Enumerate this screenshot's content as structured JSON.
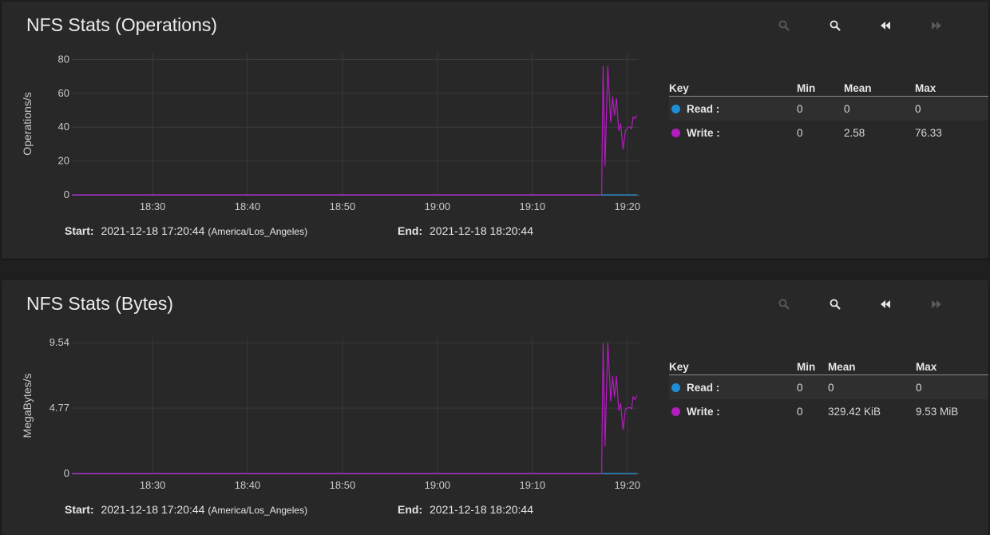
{
  "panels": [
    {
      "title": "NFS Stats (Operations)",
      "toolbar": {
        "zoom_in_icon": "zoom-in-icon",
        "zoom_out_icon": "zoom-out-icon",
        "back_icon": "rewind-icon",
        "forward_icon": "fast-forward-icon"
      },
      "footer": {
        "start_label": "Start:",
        "start_value": "2021-12-18 17:20:44",
        "start_tz": "(America/Los_Angeles)",
        "end_label": "End:",
        "end_value": "2021-12-18 18:20:44"
      },
      "legend": {
        "headers": [
          "Key",
          "Min",
          "Mean",
          "Max"
        ],
        "rows": [
          {
            "name": "Read :",
            "color": "#1e8fd6",
            "min": "0",
            "mean": "0",
            "max": "0"
          },
          {
            "name": "Write :",
            "color": "#b41cc0",
            "min": "0",
            "mean": "2.58",
            "max": "76.33"
          }
        ]
      }
    },
    {
      "title": "NFS Stats (Bytes)",
      "toolbar": {
        "zoom_in_icon": "zoom-in-icon",
        "zoom_out_icon": "zoom-out-icon",
        "back_icon": "rewind-icon",
        "forward_icon": "fast-forward-icon"
      },
      "footer": {
        "start_label": "Start:",
        "start_value": "2021-12-18 17:20:44",
        "start_tz": "(America/Los_Angeles)",
        "end_label": "End:",
        "end_value": "2021-12-18 18:20:44"
      },
      "legend": {
        "headers": [
          "Key",
          "Min",
          "Mean",
          "Max"
        ],
        "rows": [
          {
            "name": "Read :",
            "color": "#1e8fd6",
            "min": "0",
            "mean": "0",
            "max": "0"
          },
          {
            "name": "Write :",
            "color": "#b41cc0",
            "min": "0",
            "mean": "329.42 KiB",
            "max": "9.53 MiB"
          }
        ]
      }
    }
  ],
  "chart_data": [
    {
      "type": "line",
      "ylabel": "Operations/s",
      "ylim": [
        0,
        84
      ],
      "yticks": [
        0,
        20,
        40,
        60,
        80
      ],
      "ytick_labels": [
        "0",
        "20",
        "40",
        "60",
        "80"
      ],
      "xlim_minutes": [
        -58.5,
        1.2
      ],
      "xticks_minutes": [
        -50,
        -40,
        -30,
        -20,
        -10,
        0
      ],
      "xtick_labels": [
        "18:30",
        "18:40",
        "18:50",
        "19:00",
        "19:10",
        "19:20"
      ],
      "grid": true,
      "series": [
        {
          "name": "Read",
          "color": "#1e8fd6",
          "x": [
            -58.5,
            1.0
          ],
          "y": [
            0,
            0
          ]
        },
        {
          "name": "Write",
          "color": "#b41cc0",
          "x": [
            -58.5,
            -2.7,
            -2.55,
            -2.35,
            -2.05,
            -1.75,
            -1.55,
            -1.35,
            -1.15,
            -0.9,
            -0.7,
            -0.45,
            -0.2,
            0.1,
            0.3,
            0.45,
            0.6,
            0.8,
            1.0
          ],
          "y": [
            0,
            0,
            76,
            17,
            76,
            43,
            58,
            47,
            57,
            38,
            42,
            27,
            38,
            40,
            40,
            39,
            46,
            45,
            47
          ]
        }
      ]
    },
    {
      "type": "line",
      "ylabel": "MegaBytes/s",
      "ylim": [
        0,
        9.9
      ],
      "yticks": [
        0,
        4.77,
        9.54
      ],
      "ytick_labels": [
        "0",
        "4.77",
        "9.54"
      ],
      "xlim_minutes": [
        -58.5,
        1.2
      ],
      "xticks_minutes": [
        -50,
        -40,
        -30,
        -20,
        -10,
        0
      ],
      "xtick_labels": [
        "18:30",
        "18:40",
        "18:50",
        "19:00",
        "19:10",
        "19:20"
      ],
      "grid": true,
      "series": [
        {
          "name": "Read",
          "color": "#1e8fd6",
          "x": [
            -58.5,
            1.0
          ],
          "y": [
            0,
            0
          ]
        },
        {
          "name": "Write",
          "color": "#b41cc0",
          "x": [
            -58.5,
            -2.7,
            -2.55,
            -2.35,
            -2.05,
            -1.75,
            -1.55,
            -1.35,
            -1.15,
            -0.9,
            -0.7,
            -0.45,
            -0.2,
            0.1,
            0.3,
            0.45,
            0.6,
            0.8,
            1.0
          ],
          "y": [
            0,
            0,
            9.5,
            2.0,
            9.53,
            5.3,
            7.1,
            5.6,
            7.1,
            4.6,
            5.1,
            3.2,
            4.7,
            4.8,
            4.8,
            4.7,
            5.6,
            5.4,
            5.7
          ]
        }
      ]
    }
  ]
}
